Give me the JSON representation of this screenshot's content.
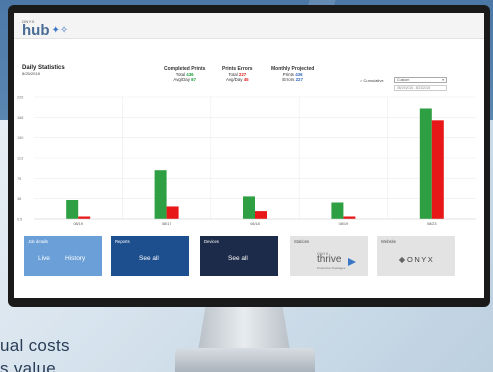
{
  "app": {
    "brand_small": "ONYX",
    "brand_name": "hub"
  },
  "header": {
    "title": "Daily Statistics",
    "date": "8/25/2018",
    "stats": [
      {
        "title": "Completed Prints",
        "row1_label": "Total",
        "row1_value": "436",
        "row2_label": "Avg/Day",
        "row2_value": "87"
      },
      {
        "title": "Prints Errors",
        "row1_label": "Total",
        "row1_value": "227",
        "row2_label": "Avg/Day",
        "row2_value": "45"
      },
      {
        "title": "Monthly Projected",
        "row1_label": "Prints",
        "row1_value": "436",
        "row2_label": "Errors",
        "row2_value": "227"
      }
    ],
    "cumulative_label": "Cumulative",
    "select_value": "Custom",
    "date_range": "08/19/2018 - 8/23/2018"
  },
  "colors": {
    "completed": "#2ea043",
    "errors": "#e81818",
    "tile_job_details": "#6a9fd8",
    "tile_reports": "#1d4f8f",
    "tile_devices": "#1c2b4a"
  },
  "chart_data": {
    "type": "bar",
    "categories": [
      "08/19",
      "08/17",
      "08/18",
      "08/19",
      "08/23"
    ],
    "series": [
      {
        "color": "#2ea043",
        "values": [
          53,
          136,
          63,
          46,
          308
        ]
      },
      {
        "color": "#e81818",
        "values": [
          7,
          35,
          22,
          7,
          275
        ]
      }
    ],
    "yticks": [
      "0.5",
      "38",
      "75",
      "113",
      "150",
      "188",
      "226"
    ],
    "ylim": [
      0,
      340
    ],
    "grid": true
  },
  "tiles": {
    "job_details": {
      "label": "Job details",
      "live": "Live",
      "history": "History"
    },
    "reports": {
      "label": "Reports",
      "see_all": "See all"
    },
    "devices": {
      "label": "Devices",
      "see_all": "See all"
    },
    "stations": {
      "label": "Stations",
      "product_brand": "ONYX",
      "product_name": "thrive",
      "product_sub": "Production Packages"
    },
    "website": {
      "label": "Website",
      "logo_text": "ONYX"
    }
  },
  "caption": {
    "line1": "ual costs",
    "line2": "s value"
  }
}
